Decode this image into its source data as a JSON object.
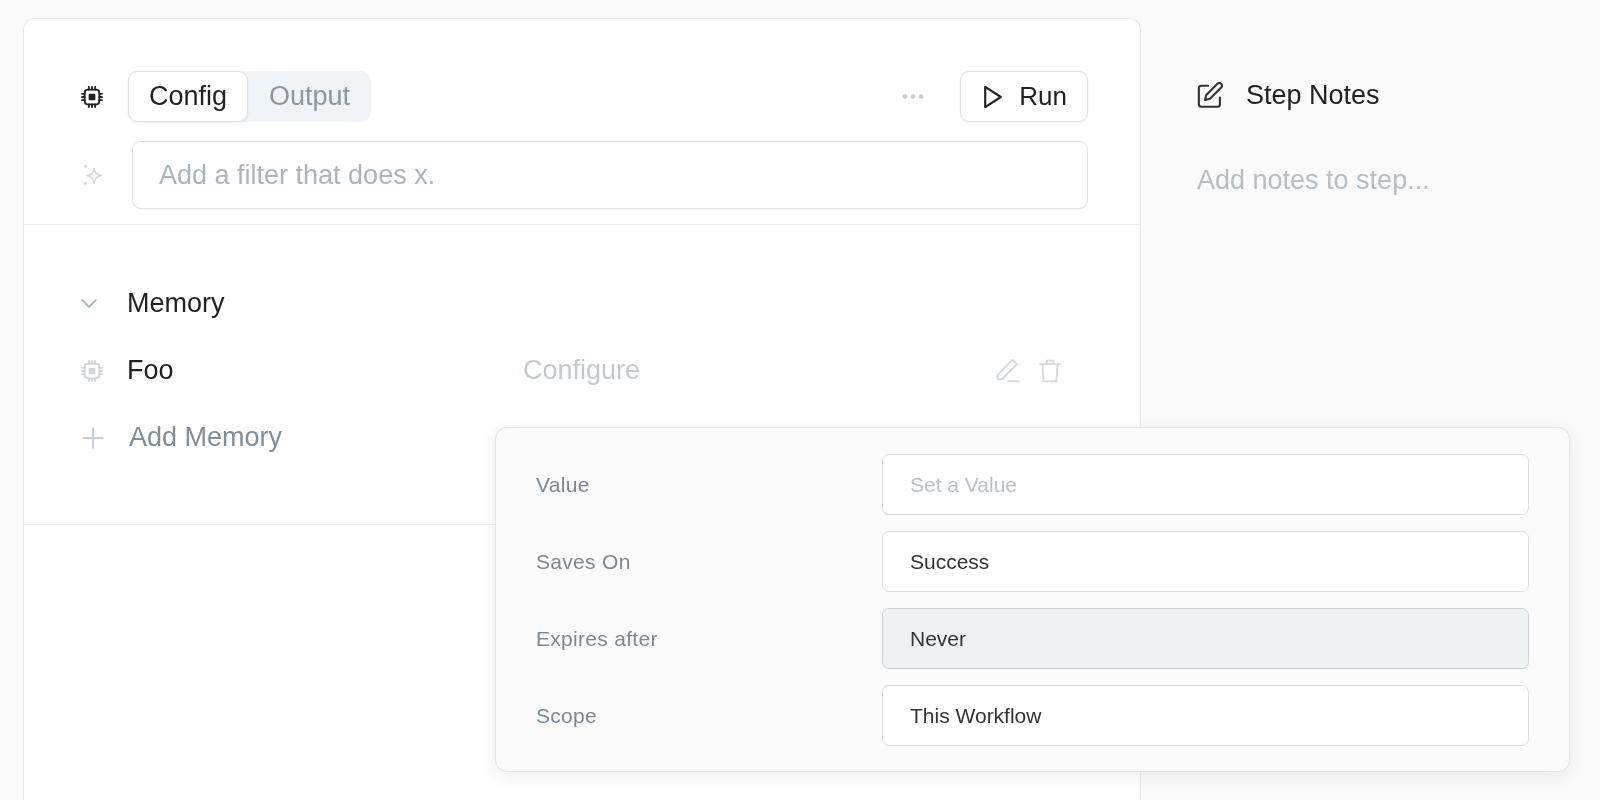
{
  "toolbar": {
    "tabs": [
      {
        "label": "Config",
        "selected": true
      },
      {
        "label": "Output",
        "selected": false
      }
    ],
    "run_button": {
      "label": "Run"
    }
  },
  "filter": {
    "placeholder": "Add a filter that does x."
  },
  "memory": {
    "title": "Memory",
    "expanded": true,
    "items": [
      {
        "name": "Foo",
        "action": "Configure"
      }
    ],
    "add_label": "Add Memory"
  },
  "popover": {
    "fields": [
      {
        "label": "Value",
        "placeholder": "Set a Value",
        "highlighted": false
      },
      {
        "label": "Saves On",
        "value": "Success",
        "highlighted": false
      },
      {
        "label": "Expires after",
        "value": "Never",
        "highlighted": true
      },
      {
        "label": "Scope",
        "value": "This Workflow",
        "highlighted": false
      }
    ]
  },
  "notes": {
    "title": "Step Notes",
    "placeholder": "Add notes to step..."
  }
}
